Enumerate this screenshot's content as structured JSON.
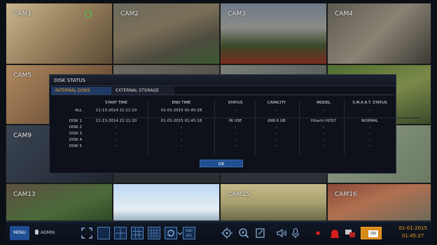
{
  "cameras": [
    {
      "label": "CAM1"
    },
    {
      "label": "CAM2"
    },
    {
      "label": "CAM3"
    },
    {
      "label": "CAM4"
    },
    {
      "label": "CAM5"
    },
    {
      "label": "CAM9"
    },
    {
      "label": "CAM13"
    },
    {
      "label": "CAM15"
    },
    {
      "label": "CAM16"
    }
  ],
  "dialog": {
    "title": "DISK STATUS",
    "tabs": [
      "INTERNAL DISKS",
      "EXTERNAL STORAGE"
    ],
    "columns": [
      "START TIME",
      "END TIME",
      "STATUS",
      "CAPACITY",
      "MODEL",
      "S.M.A.R.T. STATUS"
    ],
    "rows": [
      {
        "label": "ALL",
        "cells": [
          "11-13-2014  21:11:10",
          "01-01-2015  01:45:18",
          "-",
          "-",
          "-",
          "-"
        ]
      },
      {
        "label": "DISK 1",
        "cells": [
          "11-13-2014  21:11:10",
          "01-01-2015  01:45:18",
          "IN USE",
          "698.6 GB",
          "Hitachi HDS7",
          "NORMAL"
        ]
      },
      {
        "label": "DISK 2",
        "cells": [
          "-",
          "-",
          "-",
          "-",
          "-",
          "-"
        ]
      },
      {
        "label": "DISK 3",
        "cells": [
          "-",
          "-",
          "-",
          "-",
          "-",
          "-"
        ]
      },
      {
        "label": "DISK 4",
        "cells": [
          "-",
          "-",
          "-",
          "-",
          "-",
          "-"
        ]
      },
      {
        "label": "DISK 5",
        "cells": [
          "-",
          "-",
          "-",
          "-",
          "-",
          "-"
        ]
      }
    ],
    "ok_label": "OK"
  },
  "taskbar": {
    "menu_label": "MENU",
    "user_label": "ADMIN",
    "end_label": "END",
    "off_label": "OFF",
    "on_label": "ON",
    "date": "01-01-2015",
    "time": "01:45:27"
  },
  "colors": {
    "accent": "#f0a020",
    "button": "#1f4e8f",
    "header": "#1f3a64"
  }
}
